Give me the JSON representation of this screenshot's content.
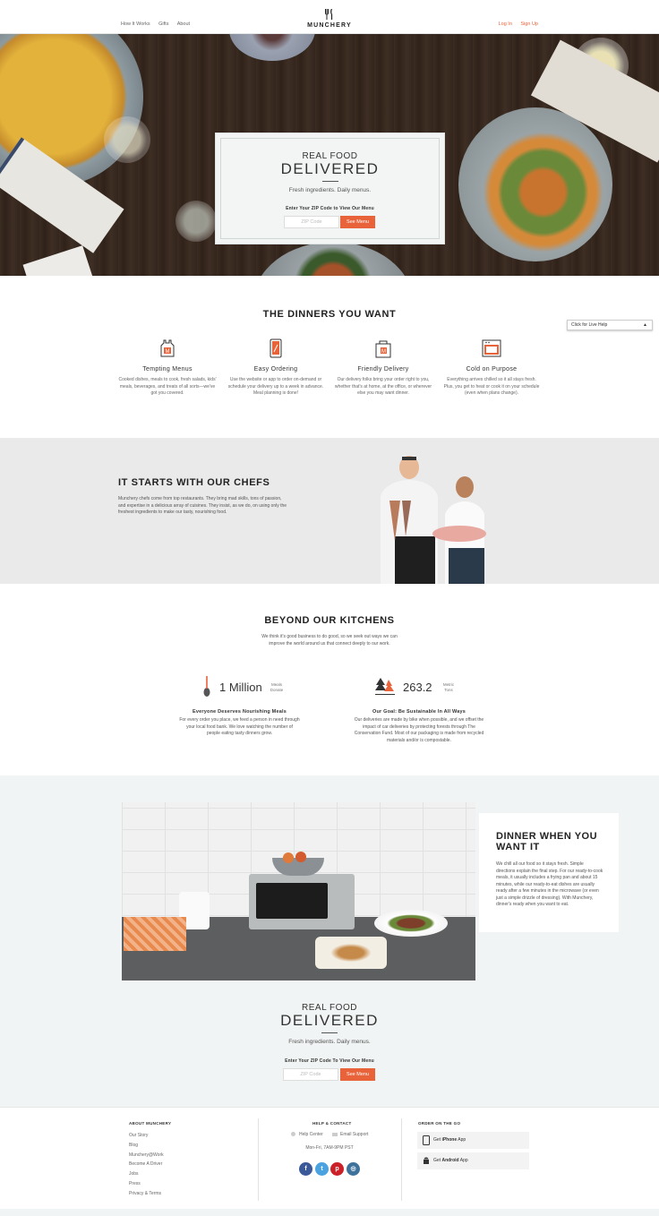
{
  "nav": {
    "links": [
      "How It Works",
      "Gifts",
      "About"
    ],
    "logo_text": "MUNCHERY",
    "login": "Log In",
    "signup": "Sign Up"
  },
  "hero": {
    "title_line1": "REAL FOOD",
    "title_line2": "DELIVERED",
    "subtitle": "Fresh ingredients. Daily menus.",
    "zip_label": "Enter Your ZIP Code to View Our Menu",
    "zip_placeholder": "ZIP Code",
    "button": "See Menu"
  },
  "dinners": {
    "title": "THE DINNERS YOU WANT",
    "features": [
      {
        "icon": "chef-apron-icon",
        "title": "Tempting Menus",
        "desc": "Cooked dishes, meals to cook, fresh salads, kids' meals, beverages, and treats of all sorts—we've got you covered."
      },
      {
        "icon": "phone-order-icon",
        "title": "Easy Ordering",
        "desc": "Use the website or app to order on-demand or schedule your delivery up to a week in advance. Meal planning is done!"
      },
      {
        "icon": "delivery-bag-icon",
        "title": "Friendly Delivery",
        "desc": "Our delivery folks bring your order right to you, whether that's at home, at the office, or wherever else you may want dinner."
      },
      {
        "icon": "oven-icon",
        "title": "Cold on Purpose",
        "desc": "Everything arrives chilled so it all stays fresh. Plus, you get to heat or cook it on your schedule (even when plans change)."
      }
    ]
  },
  "live_help": "Click for Live Help",
  "chefs": {
    "title": "IT STARTS WITH OUR CHEFS",
    "desc": "Munchery chefs come from top restaurants. They bring mad skills, tons of passion, and expertise in a delicious array of cuisines. They insist, as we do, on using only the freshest ingredients to make our tasty, nourishing food."
  },
  "beyond": {
    "title": "BEYOND OUR KITCHENS",
    "desc": "We think it's good business to do good, so we seek out ways we can improve the world around us that connect deeply to our work.",
    "stats": [
      {
        "icon": "spoon-icon",
        "value": "1 Million",
        "unit_line1": "Meals",
        "unit_line2": "Donate",
        "heading": "Everyone Deserves Nourishing Meals",
        "desc": "For every order you place, we feed a person in need through your local food bank. We love watching the number of people eating tasty dinners grow."
      },
      {
        "icon": "trees-icon",
        "value": "263.2",
        "unit_line1": "Metric",
        "unit_line2": "Tons",
        "heading": "Our Goal: Be Sustainable In All Ways",
        "desc": "Our deliveries are made by bike when possible, and we offset the impact of car deliveries by protecting forests through The Conservation Fund. Most of our packaging is made from recycled materials and/or is compostable."
      }
    ]
  },
  "dinner_when": {
    "title": "DINNER WHEN YOU WANT IT",
    "desc": "We chill all our food so it stays fresh. Simple directions explain the final step. For our ready-to-cook meals, it usually includes a frying pan and about 15 minutes, while our ready-to-eat dishes are usually ready after a few minutes in the microwave (or even just a simple drizzle of dressing). With Munchery, dinner's ready when you want to eat."
  },
  "cta": {
    "title_line1": "REAL FOOD",
    "title_line2": "DELIVERED",
    "subtitle": "Fresh ingredients. Daily menus.",
    "zip_label": "Enter Your ZIP Code To View Our Menu",
    "zip_placeholder": "ZIP Code",
    "button": "See Menu"
  },
  "footer": {
    "about_heading": "ABOUT MUNCHERY",
    "about_links": [
      "Our Story",
      "Blog",
      "Munchery@Work",
      "Become A Driver",
      "Jobs",
      "Press",
      "Privacy & Terms"
    ],
    "help_heading": "HELP & CONTACT",
    "help_center": "Help Center",
    "email_support": "Email Support",
    "hours": "Mon-Fri, 7AM-9PM PST",
    "order_heading": "ORDER ON THE GO",
    "iphone_prefix": "Get",
    "iphone_bold": "iPhone",
    "iphone_suffix": "App",
    "android_prefix": "Get",
    "android_bold": "Android",
    "android_suffix": "App",
    "social": [
      {
        "icon": "facebook-icon",
        "glyph": "f",
        "color": "#3b5998"
      },
      {
        "icon": "twitter-icon",
        "glyph": "t",
        "color": "#4aa3e0"
      },
      {
        "icon": "pinterest-icon",
        "glyph": "p",
        "color": "#cb2027"
      },
      {
        "icon": "instagram-icon",
        "glyph": "◎",
        "color": "#3f729b"
      }
    ]
  },
  "colors": {
    "accent": "#e8633a",
    "chef_bg": "#eaeaea",
    "dinner_bg": "#f1f4f4"
  }
}
